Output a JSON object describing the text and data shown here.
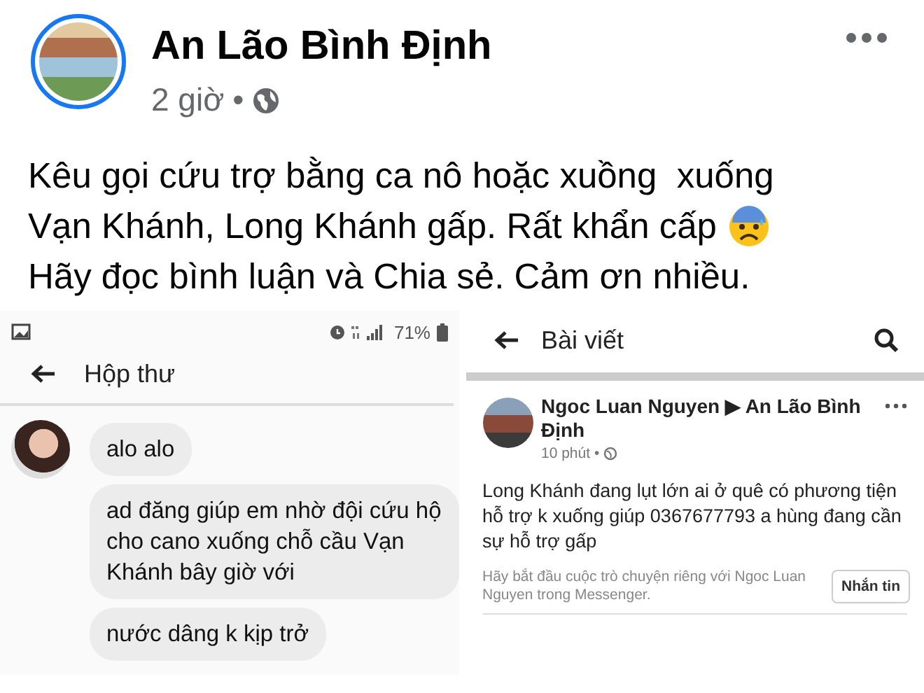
{
  "post": {
    "author": "An Lão Bình Định",
    "time": "2 giờ",
    "separator": "•",
    "text": "Kêu gọi cứu trợ bằng ca nô hoặc xuồng  xuống",
    "text_line2": "Vạn Khánh, Long Khánh gấp. Rất khẩn cấp",
    "text_end": "Hãy đọc bình luận và Chia sẻ. Cảm ơn nhiều."
  },
  "inbox_screenshot": {
    "battery": "71%",
    "title": "Hộp thư",
    "messages": [
      "alo alo",
      "ad đăng giúp em nhờ đội cứu hộ cho cano xuống chỗ cầu Vạn Khánh bây giờ với",
      "nước dâng k kịp trở"
    ]
  },
  "post_screenshot": {
    "title": "Bài viết",
    "author": "Ngoc Luan Nguyen",
    "arrow": "▶",
    "group": "An Lão Bình Định",
    "time": "10 phút",
    "separator": "•",
    "text": "Long Khánh đang lụt lớn ai ở quê có phương tiện hỗ trợ k xuống giúp 0367677793 a hùng đang cần sự hỗ trợ gấp",
    "prompt": "Hãy bắt đầu cuộc trò chuyện riêng với Ngoc Luan Nguyen trong Messenger.",
    "button": "Nhắn tin"
  }
}
